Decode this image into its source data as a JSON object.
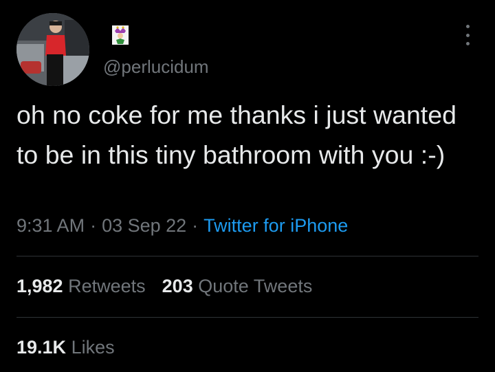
{
  "tweet": {
    "handle": "@perlucidum",
    "name_icon": "jester-emoji-icon",
    "avatar_icon": "profile-photo",
    "text": "oh no coke for me thanks i just wanted to be in this tiny bathroom with you :-)",
    "time": "9:31 AM",
    "date": "03 Sep 22",
    "separator": "·",
    "source": "Twitter for iPhone"
  },
  "stats": {
    "retweets_count": "1,982",
    "retweets_label": "Retweets",
    "quotes_count": "203",
    "quotes_label": "Quote Tweets",
    "likes_count": "19.1K",
    "likes_label": "Likes"
  },
  "colors": {
    "background": "#000000",
    "text": "#e7e9ea",
    "secondary": "#71767b",
    "link": "#1d9bf0",
    "divider": "#2f3336"
  }
}
